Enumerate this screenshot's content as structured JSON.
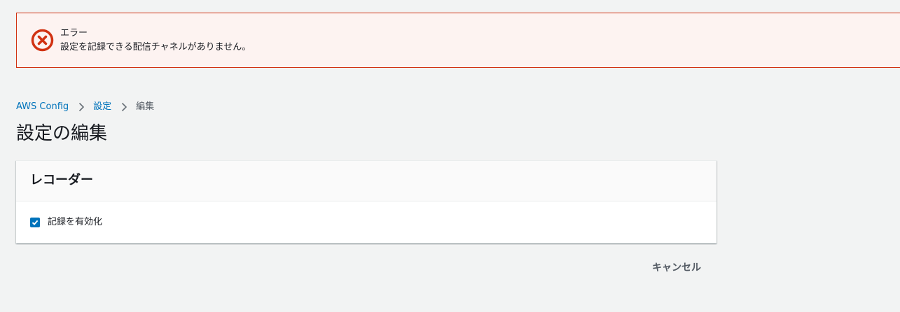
{
  "error": {
    "icon": "error-x-circle-icon",
    "title": "エラー",
    "message": "設定を記録できる配信チャネルがありません。",
    "color": "#d13212"
  },
  "breadcrumb": {
    "items": [
      {
        "label": "AWS Config"
      },
      {
        "label": "設定"
      },
      {
        "label": "編集"
      }
    ]
  },
  "page": {
    "title": "設定の編集"
  },
  "recorder_panel": {
    "title": "レコーダー",
    "enable_recording": {
      "label": "記録を有効化",
      "checked": true
    }
  },
  "actions": {
    "cancel_label": "キャンセル"
  },
  "colors": {
    "accent": "#0073bb",
    "background": "#f2f3f3",
    "error_border": "#d13212",
    "error_background": "#fdf3f1"
  }
}
